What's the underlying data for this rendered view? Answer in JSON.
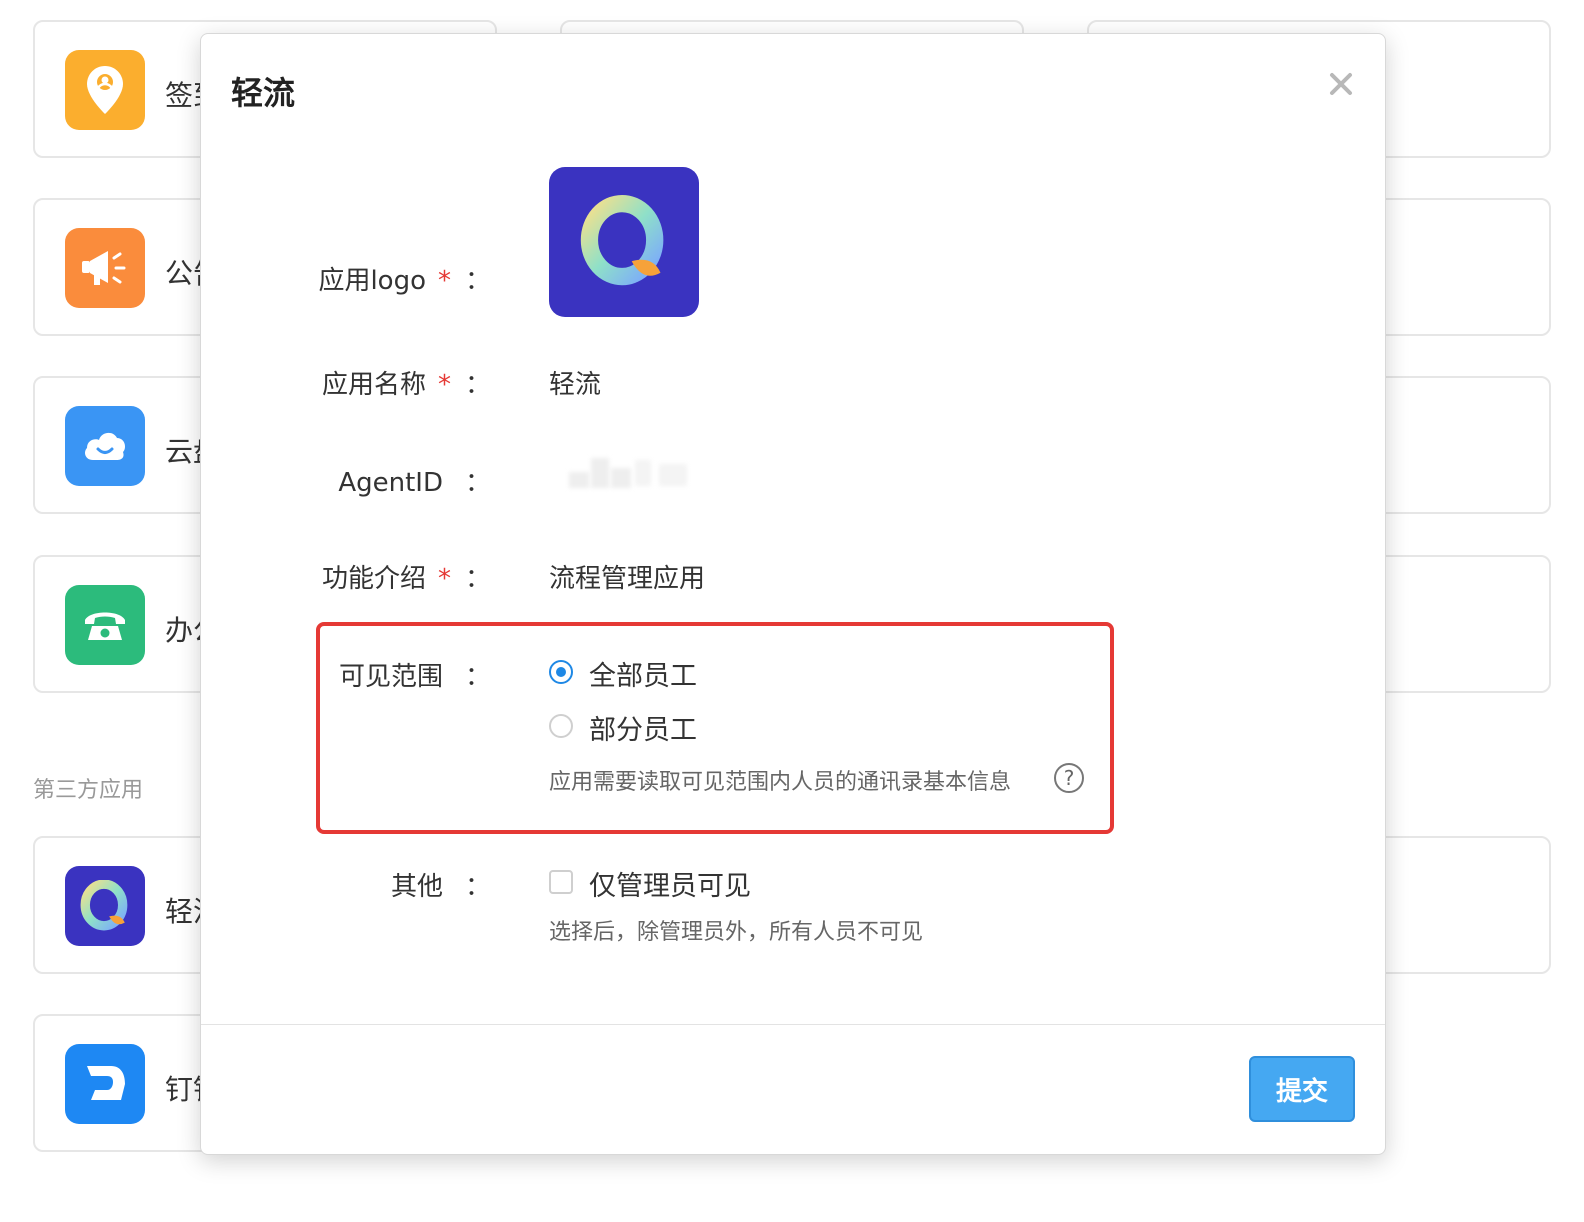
{
  "background": {
    "cards": [
      {
        "name": "签到",
        "icon": "location-icon",
        "color": "#fbae2e"
      },
      {
        "name": "公告",
        "icon": "megaphone-icon",
        "color": "#fa8c3c"
      },
      {
        "name": "云盘",
        "icon": "cloud-icon",
        "color": "#3a95f4"
      },
      {
        "name": "办公电话",
        "icon": "phone-icon",
        "color": "#2cbb7c"
      },
      {
        "name": "轻流",
        "icon": "qingliu-logo-icon",
        "color": "#3a33c0"
      },
      {
        "name": "钉钉",
        "icon": "dingtalk-icon",
        "color": "#1e88f3"
      }
    ],
    "section_label": "第三方应用"
  },
  "modal": {
    "title": "轻流",
    "form": {
      "logo_label": "应用logo",
      "name_label": "应用名称",
      "name_value": "轻流",
      "agentid_label": "AgentID",
      "desc_label": "功能介绍",
      "desc_value": "流程管理应用",
      "visibility_label": "可见范围",
      "visibility_options": [
        "全部员工",
        "部分员工"
      ],
      "visibility_selected": "全部员工",
      "visibility_hint": "应用需要读取可见范围内人员的通讯录基本信息",
      "other_label": "其他",
      "admin_only_label": "仅管理员可见",
      "admin_only_hint": "选择后，除管理员外，所有人员不可见",
      "required_mark": "*",
      "colon": "："
    },
    "submit_label": "提交"
  },
  "colors": {
    "primary": "#1e88e5",
    "required": "#e53935",
    "highlight_box": "#e53935",
    "submit_bg": "#45a8f2"
  }
}
